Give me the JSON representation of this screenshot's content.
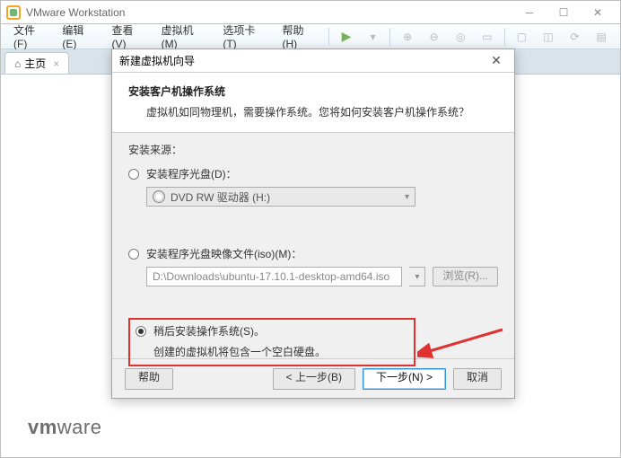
{
  "window": {
    "title": "VMware Workstation"
  },
  "menu": {
    "file": "文件(F)",
    "edit": "编辑(E)",
    "view": "查看(V)",
    "vm": "虚拟机(M)",
    "tabs": "选项卡(T)",
    "help": "帮助(H)"
  },
  "tab": {
    "home": "主页",
    "close": "×"
  },
  "brand": {
    "a": "vm",
    "b": "ware"
  },
  "dialog": {
    "title": "新建虚拟机向导",
    "heading": "安装客户机操作系统",
    "subheading": "虚拟机如同物理机，需要操作系统。您将如何安装客户机操作系统？",
    "source_label": "安装来源：",
    "opt1_label": "安装程序光盘(D)：",
    "drive_text": "DVD RW 驱动器 (H:)",
    "opt2_label": "安装程序光盘映像文件(iso)(M)：",
    "iso_path": "D:\\Downloads\\ubuntu-17.10.1-desktop-amd64.iso",
    "browse": "浏览(R)...",
    "opt3_label": "稍后安装操作系统(S)。",
    "opt3_note": "创建的虚拟机将包含一个空白硬盘。",
    "help": "帮助",
    "back": "< 上一步(B)",
    "next": "下一步(N) >",
    "cancel": "取消"
  }
}
